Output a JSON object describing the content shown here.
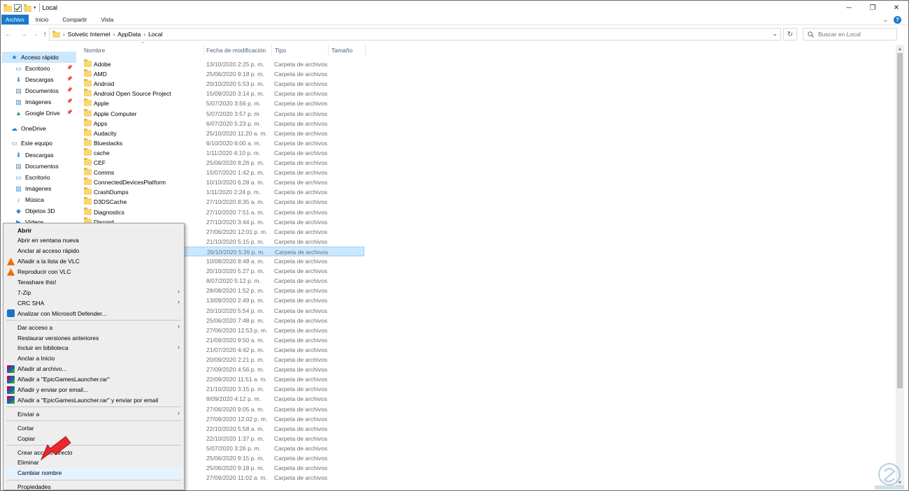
{
  "window": {
    "title": "Local",
    "controls": {
      "minimize": "─",
      "maximize": "❐",
      "close": "✕"
    }
  },
  "ribbon": {
    "tabs": [
      {
        "label": "Archivo"
      },
      {
        "label": "Inicio"
      },
      {
        "label": "Compartir"
      },
      {
        "label": "Vista"
      }
    ],
    "expand_glyph": "⌄",
    "help_glyph": "?"
  },
  "address": {
    "crumbs": [
      "Solvetic Internet",
      "AppData",
      "Local"
    ],
    "search_placeholder": "Buscar en Local"
  },
  "nav": {
    "items": [
      {
        "label": "Acceso rápido",
        "icon": "star-icon",
        "pinned": false
      },
      {
        "label": "Escritorio",
        "icon": "desktop-icon",
        "pinned": true
      },
      {
        "label": "Descargas",
        "icon": "download-icon",
        "pinned": true
      },
      {
        "label": "Documentos",
        "icon": "document-icon",
        "pinned": true
      },
      {
        "label": "Imágenes",
        "icon": "pictures-icon",
        "pinned": true
      },
      {
        "label": "Google Drive",
        "icon": "google-drive-icon",
        "pinned": true
      },
      {
        "label": "OneDrive",
        "icon": "cloud-icon",
        "pinned": false
      },
      {
        "label": "Este equipo",
        "icon": "computer-icon",
        "pinned": false
      },
      {
        "label": "Descargas",
        "icon": "download-icon",
        "pinned": false
      },
      {
        "label": "Documentos",
        "icon": "document-icon",
        "pinned": false
      },
      {
        "label": "Escritorio",
        "icon": "desktop-icon",
        "pinned": false
      },
      {
        "label": "Imágenes",
        "icon": "pictures-icon",
        "pinned": false
      },
      {
        "label": "Música",
        "icon": "music-icon",
        "pinned": false
      },
      {
        "label": "Objetos 3D",
        "icon": "3d-objects-icon",
        "pinned": false
      },
      {
        "label": "Vídeos",
        "icon": "video-icon",
        "pinned": false
      }
    ]
  },
  "columns": {
    "name": "Nombre",
    "date": "Fecha de modificación",
    "type": "Tipo",
    "size": "Tamaño"
  },
  "files": [
    {
      "name": "Adobe",
      "date": "13/10/2020 2:25 p. m.",
      "type": "Carpeta de archivos"
    },
    {
      "name": "AMD",
      "date": "25/06/2020 9:18 p. m.",
      "type": "Carpeta de archivos"
    },
    {
      "name": "Android",
      "date": "20/10/2020 5:53 p. m.",
      "type": "Carpeta de archivos"
    },
    {
      "name": "Android Open Source Project",
      "date": "15/09/2020 3:14 p. m.",
      "type": "Carpeta de archivos"
    },
    {
      "name": "Apple",
      "date": "5/07/2020 3:56 p. m.",
      "type": "Carpeta de archivos"
    },
    {
      "name": "Apple Computer",
      "date": "5/07/2020 3:57 p. m.",
      "type": "Carpeta de archivos"
    },
    {
      "name": "Apps",
      "date": "6/07/2020 5:23 p. m.",
      "type": "Carpeta de archivos"
    },
    {
      "name": "Audacity",
      "date": "25/10/2020 11:20 a. m.",
      "type": "Carpeta de archivos"
    },
    {
      "name": "Bluestacks",
      "date": "6/10/2020 6:00 a. m.",
      "type": "Carpeta de archivos"
    },
    {
      "name": "cache",
      "date": "1/11/2020 4:10 p. m.",
      "type": "Carpeta de archivos"
    },
    {
      "name": "CEF",
      "date": "25/06/2020 8:26 p. m.",
      "type": "Carpeta de archivos"
    },
    {
      "name": "Comms",
      "date": "15/07/2020 1:42 p. m.",
      "type": "Carpeta de archivos"
    },
    {
      "name": "ConnectedDevicesPlatform",
      "date": "10/10/2020 6:28 a. m.",
      "type": "Carpeta de archivos"
    },
    {
      "name": "CrashDumps",
      "date": "1/11/2020 2:24 p. m.",
      "type": "Carpeta de archivos"
    },
    {
      "name": "D3DSCache",
      "date": "27/10/2020 8:35 a. m.",
      "type": "Carpeta de archivos"
    },
    {
      "name": "Diagnostics",
      "date": "27/10/2020 7:51 a. m.",
      "type": "Carpeta de archivos"
    },
    {
      "name": "Discord",
      "date": "27/10/2020 3:44 p. m.",
      "type": "Carpeta de archivos"
    },
    {
      "name": "",
      "date": "27/06/2020 12:01 p. m.",
      "type": "Carpeta de archivos"
    },
    {
      "name": "",
      "date": "21/10/2020 5:15 p. m.",
      "type": "Carpeta de archivos"
    },
    {
      "name": "",
      "date": "26/10/2020 5:26 p. m.",
      "type": "Carpeta de archivos",
      "selected": true
    },
    {
      "name": "",
      "date": "10/08/2020 8:48 a. m.",
      "type": "Carpeta de archivos"
    },
    {
      "name": "",
      "date": "20/10/2020 5:27 p. m.",
      "type": "Carpeta de archivos"
    },
    {
      "name": "",
      "date": "8/07/2020 5:12 p. m.",
      "type": "Carpeta de archivos"
    },
    {
      "name": "",
      "date": "28/08/2020 1:52 p. m.",
      "type": "Carpeta de archivos"
    },
    {
      "name": "",
      "date": "13/09/2020 2:49 p. m.",
      "type": "Carpeta de archivos"
    },
    {
      "name": "",
      "date": "20/10/2020 5:54 p. m.",
      "type": "Carpeta de archivos"
    },
    {
      "name": "",
      "date": "25/06/2020 7:48 p. m.",
      "type": "Carpeta de archivos"
    },
    {
      "name": "",
      "date": "27/06/2020 12:53 p. m.",
      "type": "Carpeta de archivos"
    },
    {
      "name": "",
      "date": "21/09/2020 9:50 a. m.",
      "type": "Carpeta de archivos"
    },
    {
      "name": "",
      "date": "21/07/2020 4:42 p. m.",
      "type": "Carpeta de archivos"
    },
    {
      "name": "",
      "date": "20/09/2020 2:21 p. m.",
      "type": "Carpeta de archivos"
    },
    {
      "name": "",
      "date": "27/09/2020 4:56 p. m.",
      "type": "Carpeta de archivos"
    },
    {
      "name": "",
      "date": "22/09/2020 11:51 a. m.",
      "type": "Carpeta de archivos"
    },
    {
      "name": "",
      "date": "21/10/2020 3:15 p. m.",
      "type": "Carpeta de archivos"
    },
    {
      "name": "",
      "date": "8/09/2020 4:12 p. m.",
      "type": "Carpeta de archivos"
    },
    {
      "name": "",
      "date": "27/06/2020 9:05 a. m.",
      "type": "Carpeta de archivos"
    },
    {
      "name": "",
      "date": "27/09/2020 12:02 p. m.",
      "type": "Carpeta de archivos"
    },
    {
      "name": "",
      "date": "22/10/2020 5:58 a. m.",
      "type": "Carpeta de archivos"
    },
    {
      "name": "",
      "date": "22/10/2020 1:37 p. m.",
      "type": "Carpeta de archivos"
    },
    {
      "name": "",
      "date": "5/07/2020 3:26 p. m.",
      "type": "Carpeta de archivos"
    },
    {
      "name": "",
      "date": "25/06/2020 9:15 p. m.",
      "type": "Carpeta de archivos"
    },
    {
      "name": "",
      "date": "25/06/2020 9:18 p. m.",
      "type": "Carpeta de archivos"
    },
    {
      "name": "",
      "date": "27/09/2020 11:02 a. m.",
      "type": "Carpeta de archivos"
    }
  ],
  "context_menu": {
    "items": [
      {
        "label": "Abrir",
        "bold": true
      },
      {
        "label": "Abrir en ventana nueva"
      },
      {
        "label": "Anclar al acceso rápido"
      },
      {
        "label": "Añadir a la lista de VLC",
        "icon": "vlc-icon"
      },
      {
        "label": "Reproducir con VLC",
        "icon": "vlc-icon"
      },
      {
        "label": "Terashare this!"
      },
      {
        "label": "7-Zip",
        "submenu": true
      },
      {
        "label": "CRC SHA",
        "submenu": true
      },
      {
        "label": "Analizar con Microsoft Defender...",
        "icon": "defender-icon"
      },
      {
        "separator": true
      },
      {
        "label": "Dar acceso a",
        "submenu": true
      },
      {
        "label": "Restaurar versiones anteriores"
      },
      {
        "label": "Incluir en biblioteca",
        "submenu": true
      },
      {
        "label": "Anclar a Inicio"
      },
      {
        "label": "Añadir al archivo...",
        "icon": "winrar-icon"
      },
      {
        "label": "Añadir a \"EpicGamesLauncher.rar\"",
        "icon": "winrar-icon"
      },
      {
        "label": "Añadir y enviar por email...",
        "icon": "winrar-icon"
      },
      {
        "label": "Añadir a \"EpicGamesLauncher.rar\" y enviar por email",
        "icon": "winrar-icon"
      },
      {
        "separator": true
      },
      {
        "label": "Enviar a",
        "submenu": true
      },
      {
        "separator": true
      },
      {
        "label": "Cortar"
      },
      {
        "label": "Copiar"
      },
      {
        "separator": true
      },
      {
        "label": "Crear acceso directo"
      },
      {
        "label": "Eliminar"
      },
      {
        "label": "Cambiar nombre",
        "highlighted": true
      },
      {
        "separator": true
      },
      {
        "label": "Propiedades"
      }
    ]
  },
  "colors": {
    "accent": "#1979ca",
    "selection": "#cce8ff",
    "annotation_arrow": "#e8282b"
  }
}
